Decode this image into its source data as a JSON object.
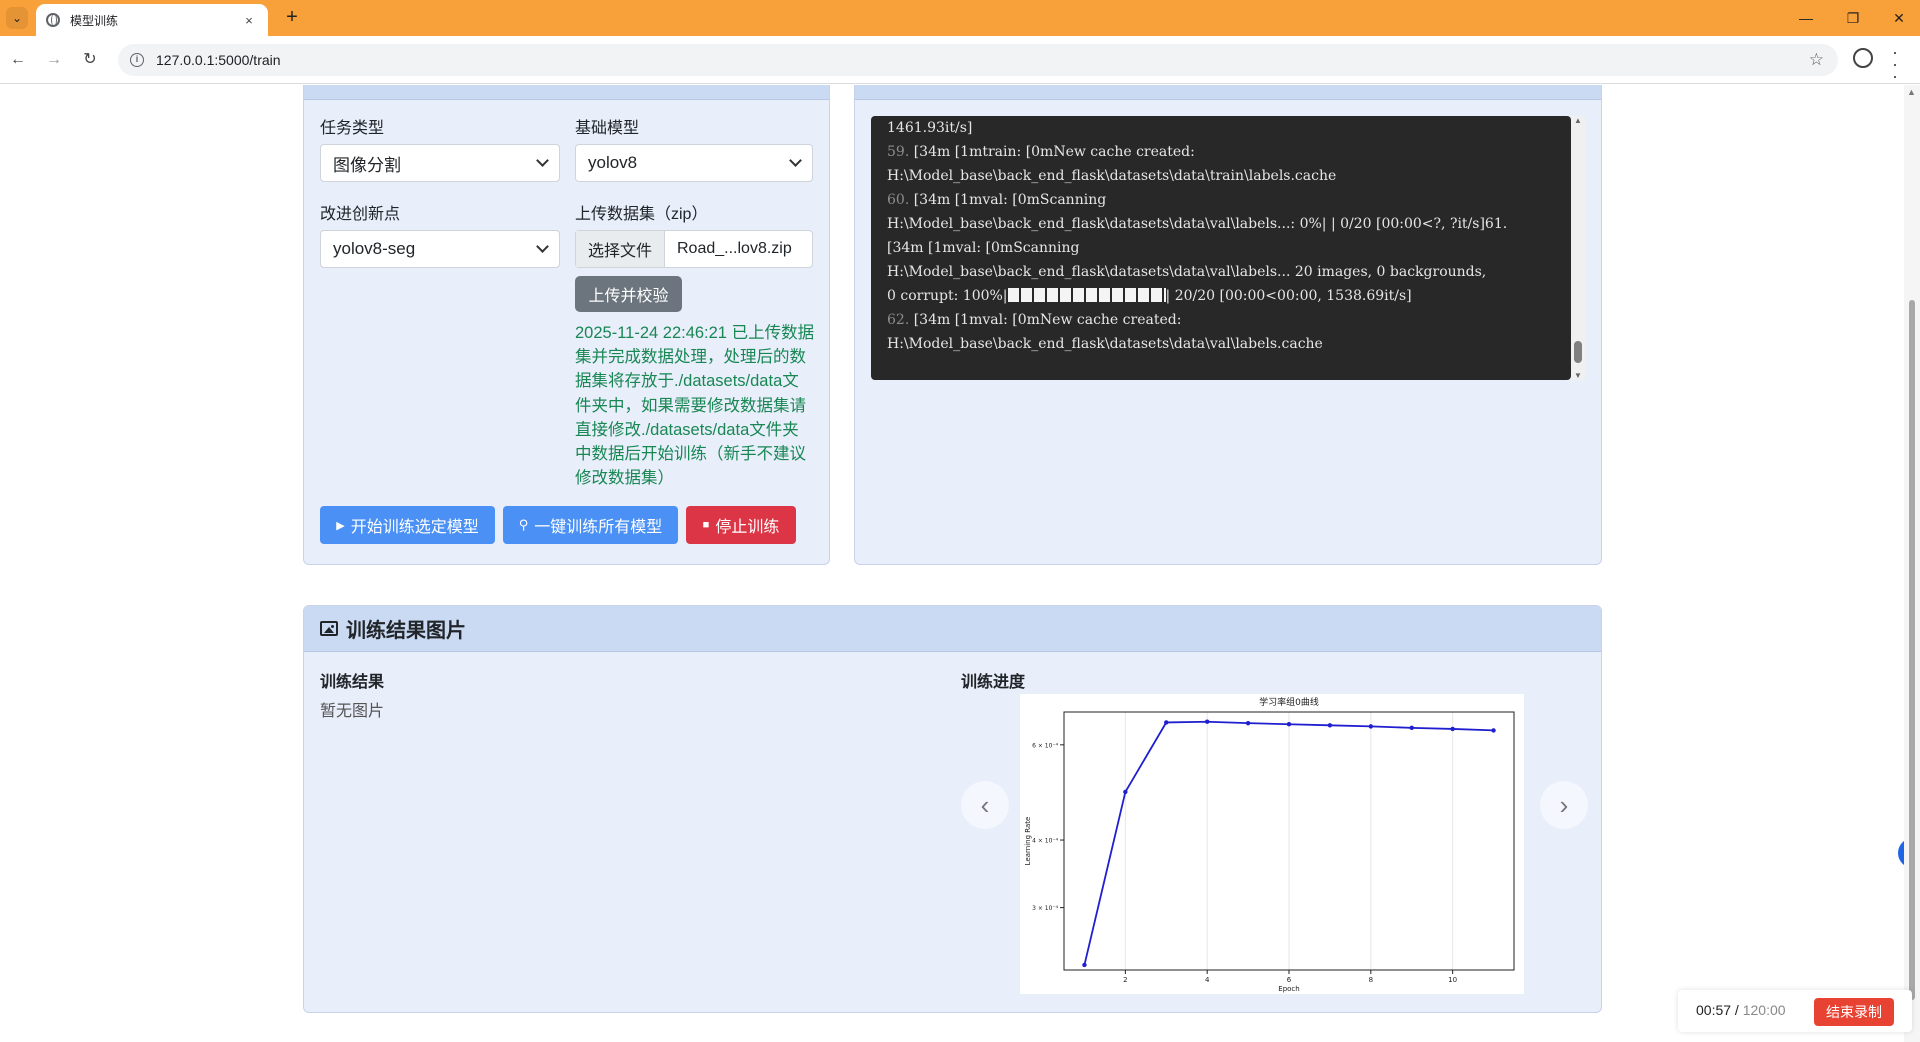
{
  "browser": {
    "tab_title": "模型训练",
    "tab_close": "×",
    "new_tab": "+",
    "url": "127.0.0.1:5000/train",
    "back": "←",
    "forward": "→",
    "reload": "↻",
    "star": "☆",
    "minimize": "—",
    "restore": "❐",
    "close": "✕"
  },
  "config": {
    "task_type_label": "任务类型",
    "task_type_value": "图像分割",
    "base_model_label": "基础模型",
    "base_model_value": "yolov8",
    "innovation_label": "改进创新点",
    "innovation_value": "yolov8-seg",
    "dataset_label": "上传数据集（zip）",
    "choose_file_label": "选择文件",
    "file_name": "Road_...lov8.zip",
    "upload_button": "上传并校验",
    "status_message": "2025-11-24 22:46:21 已上传数据集并完成数据处理，处理后的数据集将存放于./datasets/data文件夹中，如果需要修改数据集请直接修改./datasets/data文件夹中数据后开始训练（新手不建议修改数据集）",
    "start_button": "开始训练选定模型",
    "train_all_button": "一键训练所有模型",
    "stop_button": "停止训练"
  },
  "log": {
    "lines": [
      {
        "n": "",
        "t": "1461.93it/s]"
      },
      {
        "n": "59.",
        "t": "  [34m  [1mtrain:   [0mNew cache created:"
      },
      {
        "n": "",
        "t": "H:\\Model_base\\back_end_flask\\datasets\\data\\train\\labels.cache"
      },
      {
        "n": "60.",
        "t": "  [34m  [1mval:   [0mScanning"
      },
      {
        "n": "",
        "t": "H:\\Model_base\\back_end_flask\\datasets\\data\\val\\labels...: 0%|  | 0/20 [00:00<?, ?it/s]61."
      },
      {
        "n": "",
        "t": "  [34m  [1mval:   [0mScanning"
      },
      {
        "n": "",
        "t": "H:\\Model_base\\back_end_flask\\datasets\\data\\val\\labels... 20 images, 0 backgrounds,"
      },
      {
        "n": "",
        "t": "0 corrupt: 100%|",
        "bars": true,
        "t2": "| 20/20 [00:00<00:00, 1538.69it/s]"
      },
      {
        "n": "62.",
        "t": "  [34m  [1mval:   [0mNew cache created:"
      },
      {
        "n": "",
        "t": "H:\\Model_base\\back_end_flask\\datasets\\data\\val\\labels.cache"
      }
    ]
  },
  "results": {
    "header": "训练结果图片",
    "result_title": "训练结果",
    "no_image": "暂无图片",
    "progress_title": "训练进度",
    "prev": "‹",
    "next": "›"
  },
  "chart_data": {
    "type": "line",
    "title": "学习率组0曲线",
    "xlabel": "Epoch",
    "ylabel": "Learning Rate",
    "x": [
      1,
      2,
      3,
      4,
      5,
      6,
      7,
      8,
      9,
      10,
      11
    ],
    "y": [
      0.000235,
      0.000491,
      0.00066,
      0.000662,
      0.000658,
      0.000655,
      0.000652,
      0.000649,
      0.000645,
      0.000642,
      0.000638
    ],
    "xticks": [
      2,
      4,
      6,
      8,
      10
    ],
    "yticks": [
      {
        "v": 0.0003,
        "label": "3 × 10⁻⁴"
      },
      {
        "v": 0.0004,
        "label": "4 × 10⁻⁴"
      },
      {
        "v": 0.0006,
        "label": "6 × 10⁻⁴"
      }
    ],
    "yscale": "log",
    "xlim": [
      0.5,
      11.5
    ],
    "ylim": [
      0.00023,
      0.00069
    ],
    "color": "#1f1fcf",
    "grid": true
  },
  "recorder": {
    "elapsed": "00:57",
    "separator": " / ",
    "total": "120:00",
    "end_button": "结束录制"
  }
}
